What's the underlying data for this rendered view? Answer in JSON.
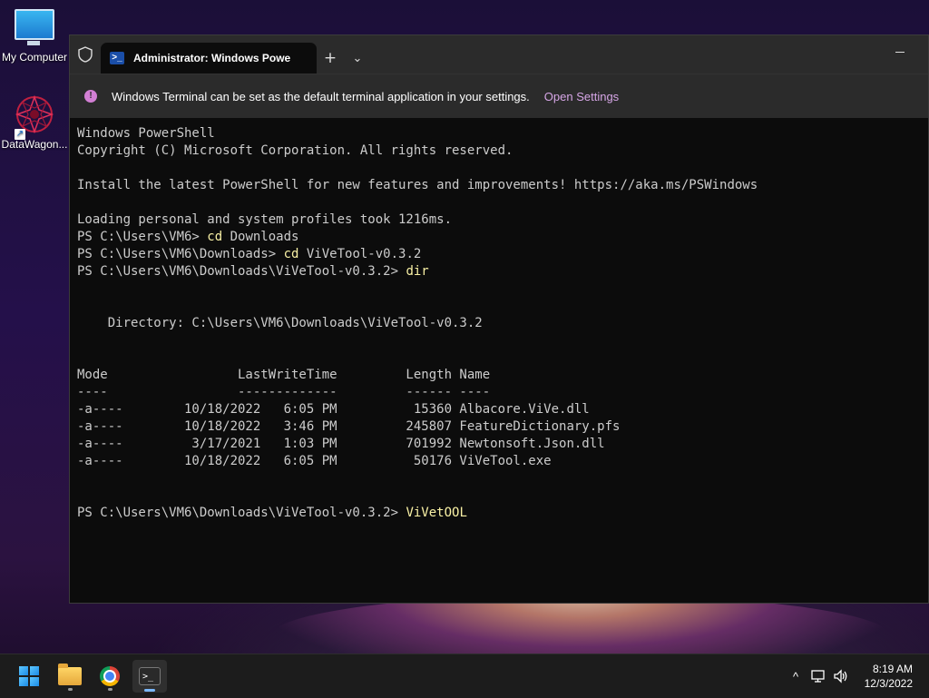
{
  "desktop": {
    "icons": [
      {
        "label": "My Computer"
      },
      {
        "label": "DataWagon..."
      }
    ]
  },
  "terminal": {
    "tab_title": "Administrator: Windows Powe",
    "new_tab_symbol": "+",
    "dropdown_symbol": "⌄",
    "infobar": {
      "message": "Windows Terminal can be set as the default terminal application in your settings.",
      "link": "Open Settings"
    },
    "console_lines": [
      {
        "text": "Windows PowerShell"
      },
      {
        "text": "Copyright (C) Microsoft Corporation. All rights reserved."
      },
      {
        "text": ""
      },
      {
        "text": "Install the latest PowerShell for new features and improvements! https://aka.ms/PSWindows"
      },
      {
        "text": ""
      },
      {
        "text": "Loading personal and system profiles took 1216ms."
      },
      {
        "prompt": "PS C:\\Users\\VM6> ",
        "cmd": "cd",
        "arg": " Downloads"
      },
      {
        "prompt": "PS C:\\Users\\VM6\\Downloads> ",
        "cmd": "cd",
        "arg": " ViVeTool-v0.3.2"
      },
      {
        "prompt": "PS C:\\Users\\VM6\\Downloads\\ViVeTool-v0.3.2> ",
        "cmd": "dir",
        "arg": ""
      },
      {
        "text": ""
      },
      {
        "text": ""
      },
      {
        "text": "    Directory: C:\\Users\\VM6\\Downloads\\ViVeTool-v0.3.2"
      },
      {
        "text": ""
      },
      {
        "text": ""
      },
      {
        "text": "Mode                 LastWriteTime         Length Name"
      },
      {
        "text": "----                 -------------         ------ ----"
      },
      {
        "text": "-a----        10/18/2022   6:05 PM          15360 Albacore.ViVe.dll"
      },
      {
        "text": "-a----        10/18/2022   3:46 PM         245807 FeatureDictionary.pfs"
      },
      {
        "text": "-a----         3/17/2021   1:03 PM         701992 Newtonsoft.Json.dll"
      },
      {
        "text": "-a----        10/18/2022   6:05 PM          50176 ViVeTool.exe"
      },
      {
        "text": ""
      },
      {
        "text": ""
      },
      {
        "prompt": "PS C:\\Users\\VM6\\Downloads\\ViVeTool-v0.3.2> ",
        "cmd": "ViVetOOL",
        "arg": ""
      }
    ]
  },
  "taskbar": {
    "clock": {
      "time": "8:19 AM",
      "date": "12/3/2022"
    },
    "tray_chevron": "^"
  },
  "colors": {
    "console_text": "#cccccc",
    "command_text": "#f9f1a5",
    "link": "#d6a6e6",
    "accent": "#7ab8ff"
  }
}
